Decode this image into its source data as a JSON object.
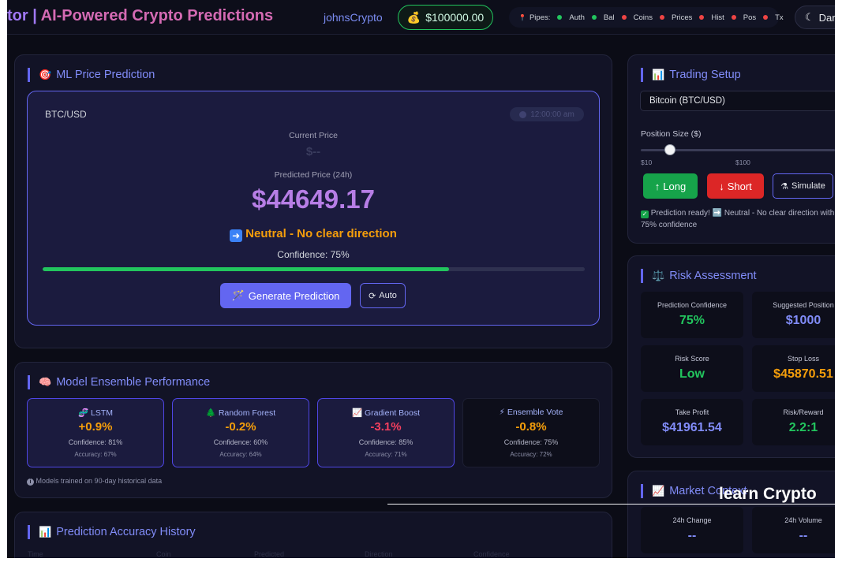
{
  "header": {
    "title_part1": "tor | ",
    "title_part2": "AI-Powered Crypto Predictions",
    "username": "johnsCrypto",
    "balance": "$100000.00",
    "pipes_label": "Pipes:",
    "pipes": [
      {
        "label": "Auth",
        "status": "green"
      },
      {
        "label": "Bal",
        "status": "green"
      },
      {
        "label": "Coins",
        "status": "red"
      },
      {
        "label": "Prices",
        "status": "red"
      },
      {
        "label": "Hist",
        "status": "red"
      },
      {
        "label": "Pos",
        "status": "red"
      },
      {
        "label": "Tx",
        "status": "red"
      }
    ],
    "theme_label": "Dark"
  },
  "ml_prediction": {
    "title": "ML Price Prediction",
    "pair": "BTC/USD",
    "timestamp": "12:00:00 am",
    "current_price_label": "Current Price",
    "current_price": "$--",
    "predicted_label": "Predicted Price (24h)",
    "predicted_price": "$44649.17",
    "direction": "Neutral - No clear direction",
    "confidence_text": "Confidence: 75%",
    "confidence": 0.75,
    "generate_label": "Generate Prediction",
    "auto_label": "Auto"
  },
  "ensemble": {
    "title": "Model Ensemble Performance",
    "models": [
      {
        "icon": "🧬",
        "name": "LSTM",
        "value": "+0.9%",
        "confidence": "Confidence: 81%",
        "accuracy": "Accuracy: 67%",
        "color": "#f59e0b"
      },
      {
        "icon": "🌲",
        "name": "Random Forest",
        "value": "-0.2%",
        "confidence": "Confidence: 60%",
        "accuracy": "Accuracy: 64%",
        "color": "#f59e0b"
      },
      {
        "icon": "📈",
        "name": "Gradient Boost",
        "value": "-3.1%",
        "confidence": "Confidence: 85%",
        "accuracy": "Accuracy: 71%",
        "color": "#f43f5e"
      },
      {
        "icon": "⚡",
        "name": "Ensemble Vote",
        "value": "-0.8%",
        "confidence": "Confidence: 75%",
        "accuracy": "Accuracy: 72%",
        "color": "#f59e0b"
      }
    ],
    "note": "Models trained on 90-day historical data"
  },
  "history": {
    "title": "Prediction Accuracy History",
    "columns": [
      "Time",
      "Coin",
      "Predicted",
      "Direction",
      "Confidence"
    ]
  },
  "trading": {
    "title": "Trading Setup",
    "selected_coin": "Bitcoin (BTC/USD)",
    "position_label": "Position Size ($)",
    "slider_value": 0.12,
    "tick_min": "$10",
    "tick_mid": "$100",
    "long_label": "Long",
    "short_label": "Short",
    "simulate_label": "Simulate",
    "status_message": "Prediction ready! ➡️ Neutral - No clear direction with 75% confidence"
  },
  "risk": {
    "title": "Risk Assessment",
    "cells": [
      {
        "label": "Prediction Confidence",
        "value": "75%",
        "color": "#22c55e"
      },
      {
        "label": "Suggested Position",
        "value": "$1000",
        "color": "#818cf8"
      },
      {
        "label": "Risk Score",
        "value": "Low",
        "color": "#22c55e"
      },
      {
        "label": "Stop Loss",
        "value": "$45870.51",
        "color": "#f59e0b"
      },
      {
        "label": "Take Profit",
        "value": "$41961.54",
        "color": "#818cf8"
      },
      {
        "label": "Risk/Reward",
        "value": "2.2:1",
        "color": "#22c55e"
      }
    ]
  },
  "market": {
    "title": "Market Context",
    "cells": [
      {
        "label": "24h Change",
        "value": "--"
      },
      {
        "label": "24h Volume",
        "value": "--"
      }
    ]
  },
  "overlay": {
    "text": "learn Crypto"
  }
}
